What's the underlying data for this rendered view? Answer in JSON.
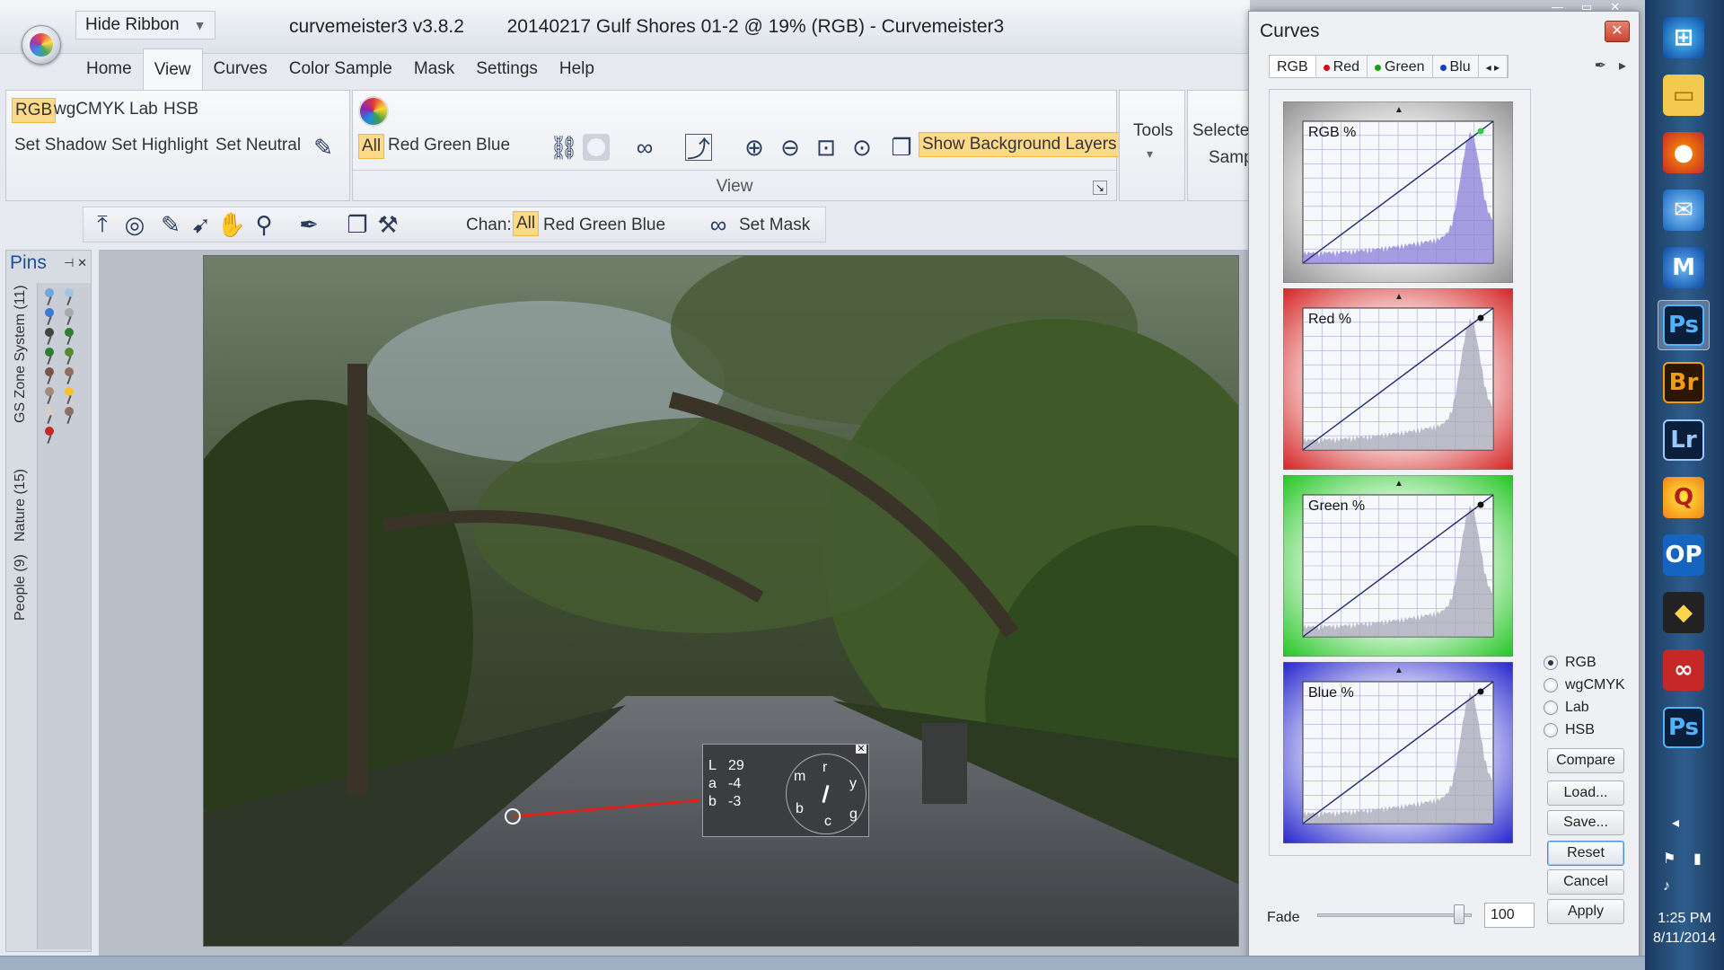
{
  "window": {
    "app_version": "curvemeister3 v3.8.2",
    "document_title": "20140217 Gulf Shores 01-2 @ 19% (RGB) - Curvemeister3",
    "hide_ribbon": "Hide Ribbon"
  },
  "menu": [
    "Home",
    "View",
    "Curves",
    "Color Sample",
    "Mask",
    "Settings",
    "Help"
  ],
  "ribbon": {
    "color_spaces": [
      "RGB",
      "wgCMYK",
      "Lab",
      "HSB"
    ],
    "set_buttons": [
      "Set Shadow",
      "Set Highlight",
      "Set Neutral"
    ],
    "view_channels": [
      "All",
      "Red",
      "Green",
      "Blue"
    ],
    "show_background_layers": "Show Background Layers",
    "view_group_label": "View",
    "tools_label": "Tools",
    "selected_samp_line1": "Selected",
    "selected_samp_line2": "Samp"
  },
  "toolbar": {
    "chan_label": "Chan:",
    "channels": [
      "All",
      "Red",
      "Green",
      "Blue"
    ],
    "set_mask": "Set Mask"
  },
  "pins": {
    "title": "Pins",
    "tabs": [
      "GS Zone System (11)",
      "Nature (15)",
      "People (9)"
    ]
  },
  "readout": {
    "rows": [
      {
        "k": "L",
        "v": "29"
      },
      {
        "k": "a",
        "v": "-4"
      },
      {
        "k": "b",
        "v": "-3"
      }
    ],
    "dial_letters": [
      "m",
      "r",
      "y",
      "b",
      "c",
      "g"
    ]
  },
  "curves": {
    "title": "Curves",
    "tabs": [
      "RGB",
      "Red",
      "Green",
      "Blu"
    ],
    "panels": [
      {
        "label": "RGB %",
        "color": "#888888"
      },
      {
        "label": "Red %",
        "color": "#d01010"
      },
      {
        "label": "Green %",
        "color": "#10c010"
      },
      {
        "label": "Blue %",
        "color": "#1010c8"
      }
    ],
    "modes": [
      "RGB",
      "wgCMYK",
      "Lab",
      "HSB"
    ],
    "selected_mode": "RGB",
    "buttons": {
      "compare": "Compare",
      "load": "Load...",
      "save": "Save...",
      "reset": "Reset",
      "cancel": "Cancel",
      "apply": "Apply"
    },
    "fade_label": "Fade",
    "fade_value": "100"
  },
  "taskbar": {
    "time": "1:25 PM",
    "date": "8/11/2014",
    "apps": [
      {
        "name": "windows-start",
        "glyph": "⊞"
      },
      {
        "name": "file-explorer",
        "glyph": "▭"
      },
      {
        "name": "firefox",
        "glyph": "●"
      },
      {
        "name": "thunderbird",
        "glyph": "✉"
      },
      {
        "name": "maxthon",
        "glyph": "M"
      },
      {
        "name": "photoshop",
        "glyph": "Ps"
      },
      {
        "name": "bridge",
        "glyph": "Br"
      },
      {
        "name": "lightroom",
        "glyph": "Lr"
      },
      {
        "name": "quicktime",
        "glyph": "Q"
      },
      {
        "name": "op",
        "glyph": "OP"
      },
      {
        "name": "nikon-capture",
        "glyph": "◆"
      },
      {
        "name": "creative-cloud",
        "glyph": "∞"
      },
      {
        "name": "photoshop-2",
        "glyph": "Ps"
      }
    ]
  },
  "colors": {
    "active_highlight": "#ffd98a",
    "accent_blue": "#1f4e99"
  }
}
